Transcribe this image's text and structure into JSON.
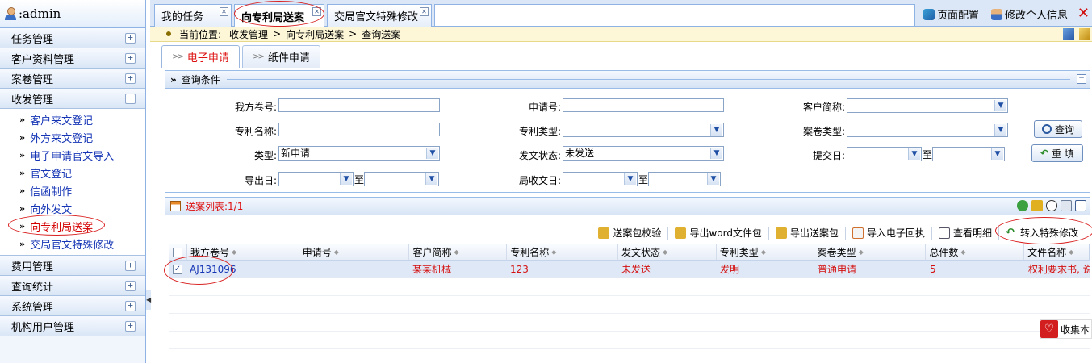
{
  "user": {
    "name": ":admin"
  },
  "sidebar": {
    "groups": [
      {
        "label": "任务管理",
        "toggle": "+"
      },
      {
        "label": "客户资料管理",
        "toggle": "+"
      },
      {
        "label": "案卷管理",
        "toggle": "+"
      },
      {
        "label": "收发管理",
        "toggle": "−"
      }
    ],
    "sub_items": [
      {
        "label": "客户来文登记"
      },
      {
        "label": "外方来文登记"
      },
      {
        "label": "电子申请官文导入"
      },
      {
        "label": "官文登记"
      },
      {
        "label": "信函制作"
      },
      {
        "label": "向外发文"
      },
      {
        "label": "向专利局送案"
      },
      {
        "label": "交局官文特殊修改"
      }
    ],
    "groups_after": [
      {
        "label": "费用管理",
        "toggle": "+"
      },
      {
        "label": "查询统计",
        "toggle": "+"
      },
      {
        "label": "系统管理",
        "toggle": "+"
      },
      {
        "label": "机构用户管理",
        "toggle": "+"
      }
    ],
    "arrows": "»"
  },
  "tabs": [
    {
      "label": "我的任务"
    },
    {
      "label": "向专利局送案"
    },
    {
      "label": "交局官文特殊修改"
    }
  ],
  "top_actions": {
    "page_config": "页面配置",
    "edit_profile": "修改个人信息",
    "close": "✕"
  },
  "breadcrumb": {
    "prefix": "当前位置:",
    "items": [
      "收发管理",
      "向专利局送案",
      "查询送案"
    ],
    "separator": ">"
  },
  "subtabs": [
    {
      "label": "电子申请",
      "arrows": ">>"
    },
    {
      "label": "纸件申请",
      "arrows": ">>"
    }
  ],
  "query": {
    "title": "查询条件",
    "fields": {
      "our_ref": {
        "label": "我方卷号:",
        "value": ""
      },
      "app_no": {
        "label": "申请号:",
        "value": ""
      },
      "client": {
        "label": "客户简称:",
        "value": ""
      },
      "patent_name": {
        "label": "专利名称:",
        "value": ""
      },
      "patent_type": {
        "label": "专利类型:",
        "value": ""
      },
      "case_type": {
        "label": "案卷类型:",
        "value": ""
      },
      "type": {
        "label": "类型:",
        "value": "新申请"
      },
      "send_status": {
        "label": "发文状态:",
        "value": "未发送"
      },
      "submit_date": {
        "label": "提交日:",
        "from": "",
        "to": ""
      },
      "export_date": {
        "label": "导出日:",
        "from": "",
        "to": ""
      },
      "receive_date": {
        "label": "局收文日:",
        "from": "",
        "to": ""
      },
      "to_label": "至"
    },
    "buttons": {
      "search": "查询",
      "reset": "重 填"
    }
  },
  "list": {
    "title": "送案列表:1/1",
    "toolbar": [
      "送案包校验",
      "导出word文件包",
      "导出送案包",
      "导入电子回执",
      "查看明细",
      "转入特殊修改"
    ],
    "columns": [
      "我方卷号",
      "申请号",
      "客户简称",
      "专利名称",
      "发文状态",
      "专利类型",
      "案卷类型",
      "总件数",
      "文件名称"
    ],
    "rows": [
      {
        "checked": "✓",
        "our_ref": "AJ131096",
        "app_no": "",
        "client": "某某机械",
        "patent_name": "123",
        "send_status": "未发送",
        "patent_type": "发明",
        "case_type": "普通申请",
        "count": "5",
        "files": "权利要求书, 说"
      }
    ]
  },
  "collect": {
    "label": "收集本",
    "icon": "♡"
  },
  "colors": {
    "accent_red": "#d41010",
    "link_blue": "#1535b5",
    "border_blue": "#99bbe8"
  }
}
